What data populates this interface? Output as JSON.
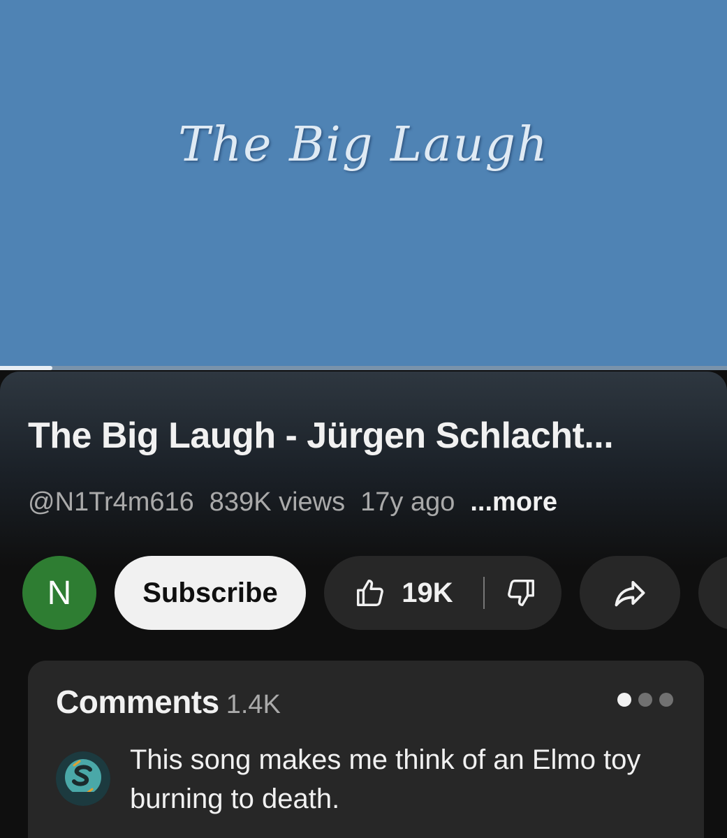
{
  "player": {
    "title_card_text": "The Big Laugh",
    "progress": 0.072
  },
  "video": {
    "title": "The Big Laugh - Jürgen Schlacht...",
    "channel_handle": "@N1Tr4m616",
    "views": "839K views",
    "age": "17y ago",
    "more_label": "...more"
  },
  "actions": {
    "avatar_letter": "N",
    "subscribe_label": "Subscribe",
    "like_count": "19K"
  },
  "comments": {
    "title": "Comments",
    "count": "1.4K",
    "top_comment": "This song makes me think of an Elmo toy burning to death.",
    "page_indicator": {
      "total": 3,
      "active": 1
    }
  },
  "colors": {
    "player_bg": "#4f83b4",
    "avatar_bg": "#2e7d32",
    "button_bg": "#272727",
    "subscribe_bg": "#f1f1f1"
  },
  "icons": [
    "thumb-up-icon",
    "thumb-down-icon",
    "share-icon",
    "commenter-avatar-icon"
  ]
}
